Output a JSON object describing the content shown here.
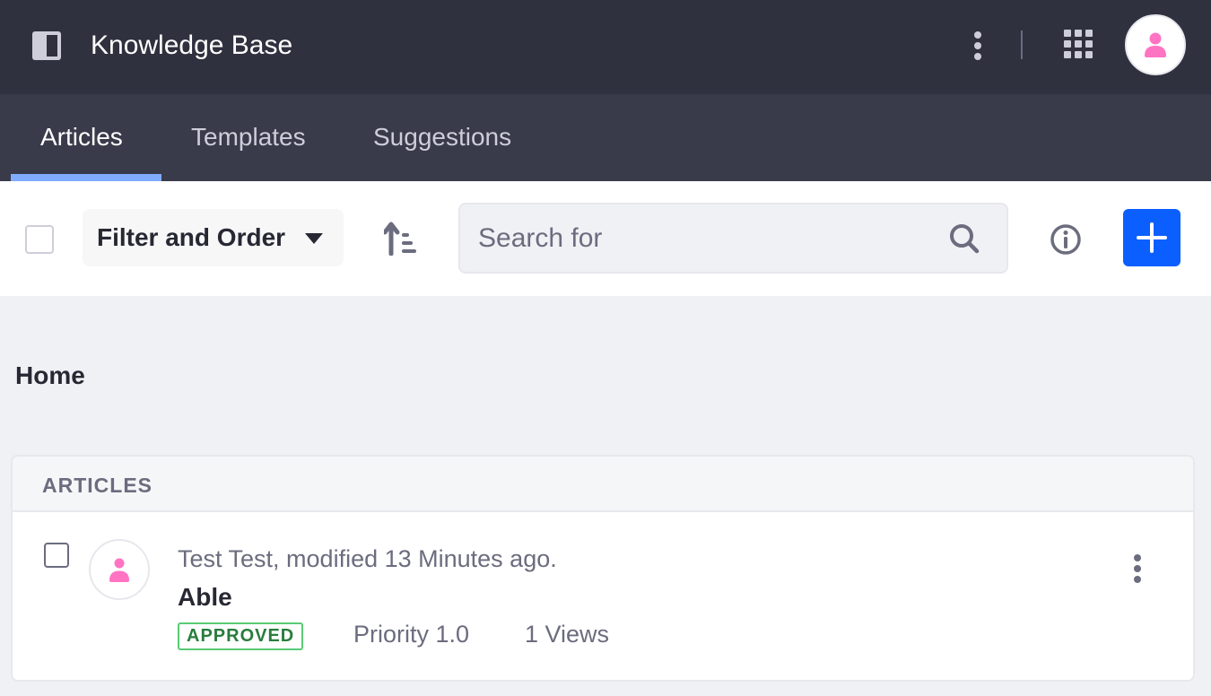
{
  "header": {
    "app_title": "Knowledge Base",
    "icons": {
      "sidebar_toggle": "sidebar-panel-icon",
      "options": "vertical-ellipsis-icon",
      "apps": "apps-grid-icon",
      "user": "user-avatar-icon"
    }
  },
  "tabs": [
    {
      "label": "Articles",
      "active": true
    },
    {
      "label": "Templates",
      "active": false
    },
    {
      "label": "Suggestions",
      "active": false
    }
  ],
  "toolbar": {
    "filter_label": "Filter and Order",
    "search_placeholder": "Search for",
    "search_value": "",
    "icons": {
      "filter_caret": "caret-down-icon",
      "order": "order-arrow-up-icon",
      "search": "search-icon",
      "info": "info-circle-icon",
      "add": "plus-icon"
    }
  },
  "breadcrumb": {
    "current": "Home"
  },
  "articles_panel": {
    "header": "ARTICLES",
    "items": [
      {
        "meta": "Test Test, modified 13 Minutes ago.",
        "title": "Able",
        "status": "APPROVED",
        "priority": "Priority 1.0",
        "views": "1 Views"
      }
    ]
  },
  "colors": {
    "topbar_bg": "#30313f",
    "tabbar_bg": "#393a4a",
    "tab_active_indicator": "#80acff",
    "primary": "#0b5fff",
    "avatar_accent": "#ff73c3",
    "status_approved_border": "#5aca75",
    "status_approved_text": "#287d3c",
    "page_bg": "#f0f1f5"
  }
}
